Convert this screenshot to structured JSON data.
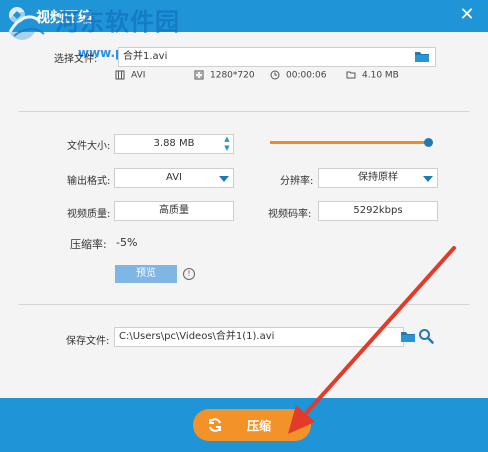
{
  "title": "视频压缩",
  "watermark": {
    "site": "河东软件园",
    "url": "www.pc0359.cn"
  },
  "source": {
    "label": "选择文件:",
    "value": "合并1.avi"
  },
  "info": {
    "format": "AVI",
    "resolution": "1280*720",
    "duration": "00:00:06",
    "size": "4.10 MB"
  },
  "form": {
    "filesize_label": "文件大小:",
    "filesize_value": "3.88 MB",
    "slider_percent": 95,
    "output_format_label": "输出格式:",
    "output_format_value": "AVI",
    "resolution_label": "分辨率:",
    "resolution_value": "保持原样",
    "quality_label": "视频质量:",
    "quality_value": "高质量",
    "bitrate_label": "视频码率:",
    "bitrate_value": "5292kbps",
    "ratio_label": "压缩率:",
    "ratio_value": "-5%",
    "preview_label": "预览",
    "help_symbol": "!"
  },
  "save": {
    "label": "保存文件:",
    "path": "C:\\Users\\pc\\Videos\\合并1(1).avi"
  },
  "action": {
    "compress_label": "压缩"
  },
  "colors": {
    "accent": "#1f95d8",
    "orange": "#f39229",
    "arrow": "#e23b2a"
  }
}
